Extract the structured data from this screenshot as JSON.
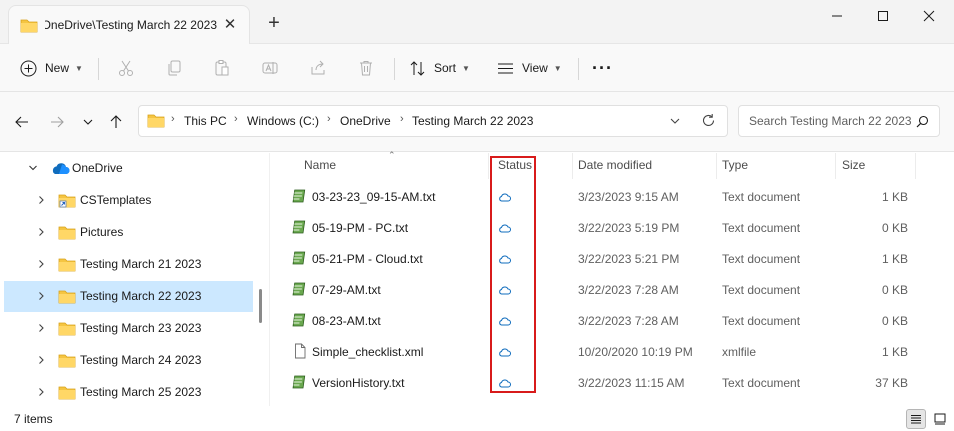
{
  "tab": {
    "title": "OneDrive\\Testing March 22 2023",
    "close_glyph": "✕",
    "new_tab_glyph": "+"
  },
  "toolbar": {
    "new_label": "New",
    "sort_label": "Sort",
    "view_label": "View",
    "more_glyph": "···"
  },
  "address": {
    "crumbs": [
      "This PC",
      "Windows (C:)",
      "OneDrive",
      "Testing March 22 2023"
    ],
    "search_placeholder": "Search Testing March 22 2023"
  },
  "sidebar": {
    "items": [
      {
        "label": "OneDrive",
        "icon": "cloud-icon"
      },
      {
        "label": "CSTemplates",
        "icon": "folder-shortcut-icon"
      },
      {
        "label": "Pictures",
        "icon": "folder-icon"
      },
      {
        "label": "Testing March 21 2023",
        "icon": "folder-icon"
      },
      {
        "label": "Testing March 22 2023",
        "icon": "folder-icon"
      },
      {
        "label": "Testing March 23 2023",
        "icon": "folder-icon"
      },
      {
        "label": "Testing March 24 2023",
        "icon": "folder-icon"
      },
      {
        "label": "Testing March 25 2023",
        "icon": "folder-icon"
      }
    ],
    "selected": "Testing March 22 2023"
  },
  "columns": {
    "name": "Name",
    "status": "Status",
    "date": "Date modified",
    "type": "Type",
    "size": "Size"
  },
  "files": [
    {
      "name": "03-23-23_09-15-AM.txt",
      "date": "3/23/2023 9:15 AM",
      "type": "Text document",
      "size": "1 KB",
      "icon": "notepad-icon"
    },
    {
      "name": "05-19-PM - PC.txt",
      "date": "3/22/2023 5:19 PM",
      "type": "Text document",
      "size": "0 KB",
      "icon": "notepad-icon"
    },
    {
      "name": "05-21-PM - Cloud.txt",
      "date": "3/22/2023 5:21 PM",
      "type": "Text document",
      "size": "1 KB",
      "icon": "notepad-icon"
    },
    {
      "name": "07-29-AM.txt",
      "date": "3/22/2023 7:28 AM",
      "type": "Text document",
      "size": "0 KB",
      "icon": "notepad-icon"
    },
    {
      "name": "08-23-AM.txt",
      "date": "3/22/2023 7:28 AM",
      "type": "Text document",
      "size": "0 KB",
      "icon": "notepad-icon"
    },
    {
      "name": "Simple_checklist.xml",
      "date": "10/20/2020 10:19 PM",
      "type": "xmlfile",
      "size": "1 KB",
      "icon": "document-icon"
    },
    {
      "name": "VersionHistory.txt",
      "date": "3/22/2023 11:15 AM",
      "type": "Text document",
      "size": "37 KB",
      "icon": "notepad-icon"
    }
  ],
  "file_status_icon": "cloud-outline-icon",
  "statusbar": {
    "item_count": "7 items"
  },
  "colors": {
    "selection": "#cce8ff",
    "cloud": "#0f6cbd",
    "highlight": "#d81b1b",
    "folder": "#f5c542"
  }
}
